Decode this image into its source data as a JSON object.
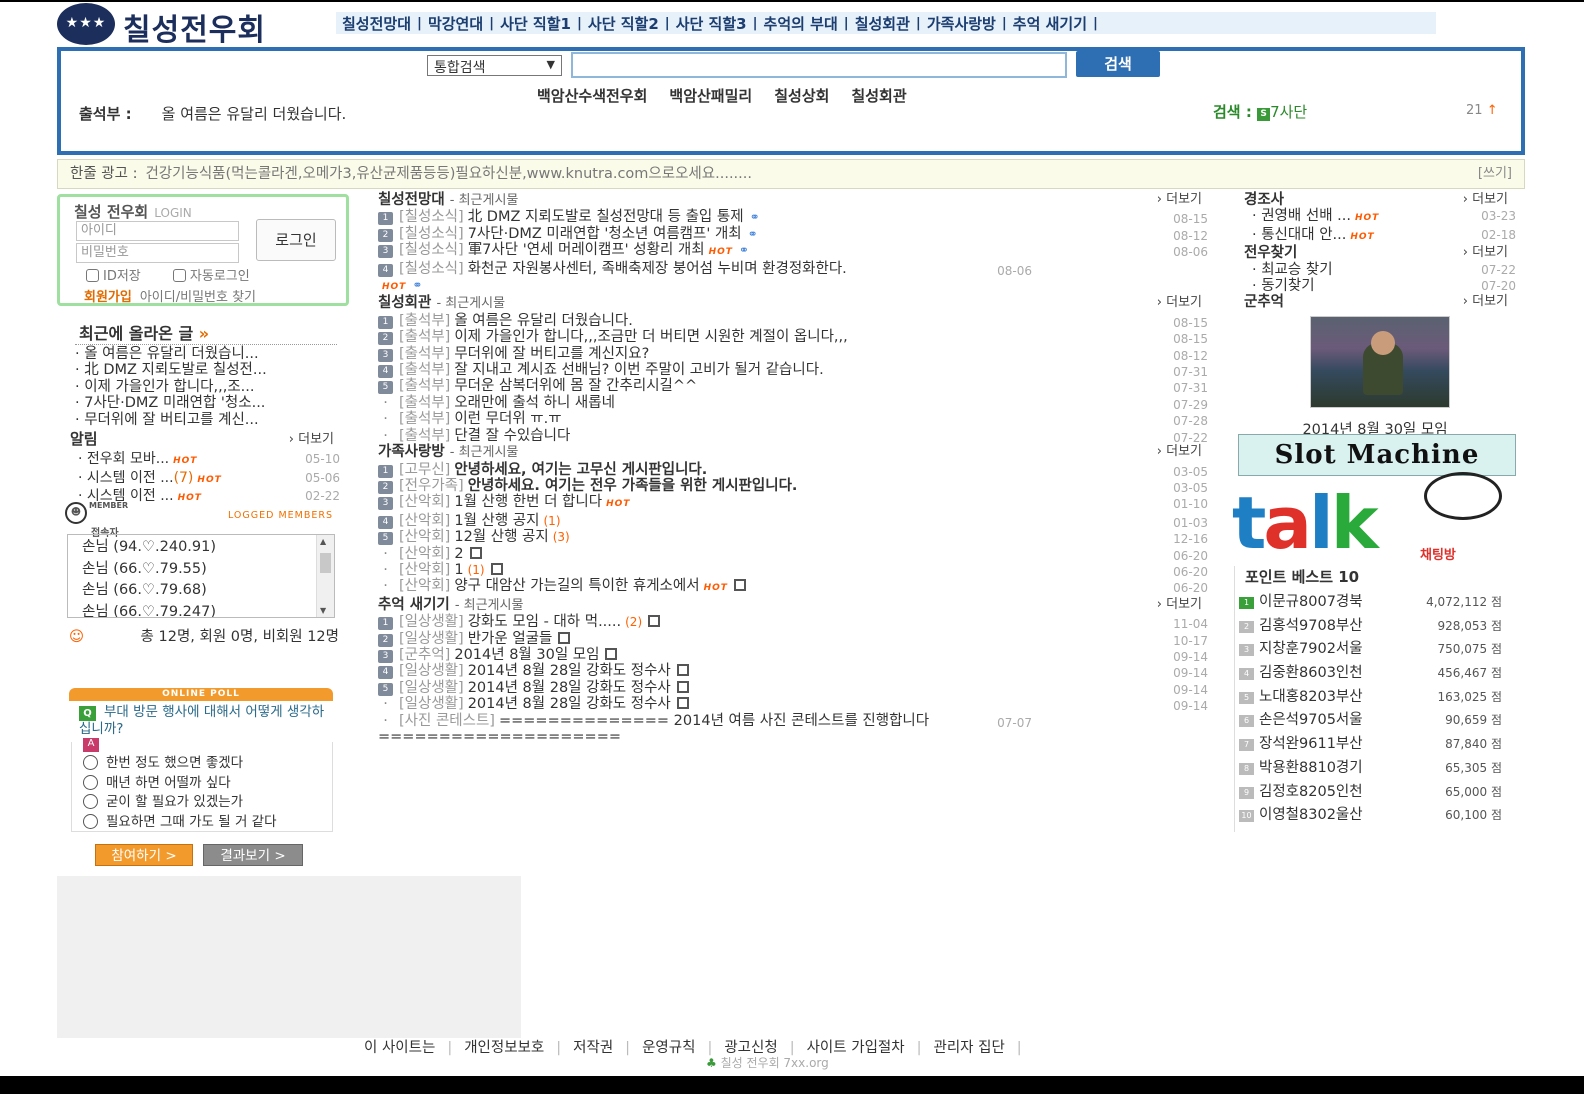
{
  "site": {
    "logo_text": "칠성전우회",
    "logo_stars": "★★★"
  },
  "topnav": [
    "칠성전망대",
    "막강연대",
    "사단 직할1",
    "사단 직할2",
    "사단 직할3",
    "추억의 부대",
    "칠성회관",
    "가족사랑방",
    "추억 새기기"
  ],
  "search": {
    "select_value": "통합검색",
    "button": "검색",
    "links": [
      "백암산수색전우회",
      "백암산패밀리",
      "칠성상회",
      "칠성회관"
    ],
    "attend_label": "출석부 :",
    "attend_text": "올 여름은 유달리 더웠습니다.",
    "find_label": "검색 :",
    "find_icon": "S",
    "find_value": "7사단",
    "count": "21",
    "count_arrow": "↑"
  },
  "ad": {
    "label": "한줄 광고 :",
    "text": "건강기능식품(먹는콜라겐,오메가3,유산균제품등등)필요하신분,www.knutra.com으로오세요........",
    "write": "[쓰기]"
  },
  "login": {
    "title": "칠성 전우회",
    "title_en": "LOGIN",
    "id_placeholder": "아이디",
    "pw_placeholder": "비밀번호",
    "button": "로그인",
    "save_id": "ID저장",
    "auto_login": "자동로그인",
    "join": "회원가입",
    "find": "아이디/비밀번호 찾기"
  },
  "recent": {
    "title": "최근에 올라온 글",
    "arrow": "»",
    "items": [
      "올 여름은 유달리 더웠습니...",
      "北 DMZ 지뢰도발로 칠성전...",
      "이제 가을인가 합니다,,,조...",
      "7사단·DMZ 미래연합 '청소...",
      "무더위에 잘 버티고를 계신..."
    ]
  },
  "notice": {
    "title": "알림",
    "more": "더보기",
    "items": [
      {
        "title": "전우회 모바...",
        "extra": "",
        "hot": "HOT",
        "date": "05-10"
      },
      {
        "title": "시스템 이전 ...",
        "extra": "(7)",
        "hot": "HOT",
        "date": "05-06"
      },
      {
        "title": "시스템 이전 ...",
        "extra": "",
        "hot": "HOT",
        "date": "02-22"
      }
    ]
  },
  "members": {
    "icon_text": "MEMBER",
    "title": "접속자",
    "logged": "LOGGED MEMBERS",
    "list": [
      "손님 (94.♡.240.91)",
      "손님 (66.♡.79.55)",
      "손님 (66.♡.79.68)",
      "손님 (66.♡.79.247)"
    ],
    "total": "총 12명, 회원 0명, 비회원 12명"
  },
  "poll": {
    "bar": "ONLINE POLL",
    "q_icon": "Q",
    "a_icon": "A",
    "question": "부대 방문 행사에 대해서 어떻게 생각하십니까?",
    "options": [
      "한번 정도 했으면 좋겠다",
      "매년 하면 어떨까 싶다",
      "굳이 할 필요가 있겠는가",
      "필요하면 그때 가도 될 거 같다"
    ],
    "vote": "참여하기 >",
    "result": "결과보기 >"
  },
  "center": {
    "more": "더보기",
    "sub": "- 최근게시물",
    "sections": [
      {
        "title": "칠성전망대",
        "rows": [
          {
            "n": "1",
            "cat": "[칠성소식]",
            "text": "北 DMZ 지뢰도발로 칠성전망대 등 출입 통제",
            "bold": false,
            "hot": "",
            "clip": "⚭",
            "cnt": "",
            "save": false,
            "date": "08-15"
          },
          {
            "n": "2",
            "cat": "[칠성소식]",
            "text": "7사단·DMZ 미래연합 '청소년 여름캠프' 개최",
            "bold": false,
            "hot": "",
            "clip": "⚭",
            "cnt": "",
            "save": false,
            "date": "08-12"
          },
          {
            "n": "3",
            "cat": "[칠성소식]",
            "text": "軍7사단 '연세 머레이캠프' 성황리 개최",
            "bold": false,
            "hot": "HOT",
            "clip": "⚭",
            "cnt": "",
            "save": false,
            "date": "08-06"
          },
          {
            "n": "4",
            "cat": "[칠성소식]",
            "text": "화천군 자원봉사센터, 족배축제장 붕어섬 누비며 환경정화한다.",
            "bold": false,
            "hot": "HOT",
            "clip": "⚭",
            "cnt": "",
            "save": false,
            "date": "08-06",
            "wrap": true
          }
        ]
      },
      {
        "title": "칠성회관",
        "rows": [
          {
            "n": "1",
            "cat": "[출석부]",
            "text": "올 여름은 유달리 더웠습니다.",
            "date": "08-15"
          },
          {
            "n": "2",
            "cat": "[출석부]",
            "text": "이제 가을인가 합니다,,,조금만 더 버티면 시원한 계절이 옵니다,,,",
            "date": "08-15"
          },
          {
            "n": "3",
            "cat": "[출석부]",
            "text": "무더위에 잘 버티고를 계신지요?",
            "date": "08-12"
          },
          {
            "n": "4",
            "cat": "[출석부]",
            "text": "잘 지내고 계시죠 선배님? 이번 주말이 고비가 될거 같습니다.",
            "date": "07-31"
          },
          {
            "n": "5",
            "cat": "[출석부]",
            "text": "무더운 삼복더위에 몸 잘 간추리시길^^",
            "date": "07-31"
          },
          {
            "n": "·",
            "cat": "[출석부]",
            "text": "오래만에 출석 하니 새롭네",
            "date": "07-29"
          },
          {
            "n": "·",
            "cat": "[출석부]",
            "text": "이런 무더위 ㅠ.ㅠ",
            "date": "07-28"
          },
          {
            "n": "·",
            "cat": "[출석부]",
            "text": "단결 잘 수있습니다",
            "date": "07-22"
          }
        ]
      },
      {
        "title": "가족사랑방",
        "rows": [
          {
            "n": "1",
            "cat": "[고무신]",
            "text": "안녕하세요, 여기는 고무신 게시판입니다.",
            "bold": true,
            "date": "03-05"
          },
          {
            "n": "2",
            "cat": "[전우가족]",
            "text": "안녕하세요. 여기는 전우 가족들을 위한 게시판입니다.",
            "bold": true,
            "date": "03-05"
          },
          {
            "n": "3",
            "cat": "[산악회]",
            "text": "1월 산행 한번 더 합니다",
            "hot": "HOT",
            "date": "01-10"
          },
          {
            "n": "4",
            "cat": "[산악회]",
            "text": "1월 산행 공지",
            "cnt": "(1)",
            "date": "01-03"
          },
          {
            "n": "5",
            "cat": "[산악회]",
            "text": "12월 산행 공지",
            "cnt": "(3)",
            "date": "12-16"
          },
          {
            "n": "·",
            "cat": "[산악회]",
            "text": "2",
            "save": true,
            "date": "06-20"
          },
          {
            "n": "·",
            "cat": "[산악회]",
            "text": "1",
            "cnt": "(1)",
            "save": true,
            "date": "06-20"
          },
          {
            "n": "·",
            "cat": "[산악회]",
            "text": "양구 대암산 가는길의 특이한 휴게소에서",
            "hot": "HOT",
            "save": true,
            "date": "06-20"
          }
        ]
      },
      {
        "title": "추억 새기기",
        "rows": [
          {
            "n": "1",
            "cat": "[일상생활]",
            "text": "강화도 모임 - 대하 먹.....",
            "cnt": "(2)",
            "save": true,
            "date": "11-04"
          },
          {
            "n": "2",
            "cat": "[일상생활]",
            "text": "반가운 얼굴들",
            "save": true,
            "date": "10-17"
          },
          {
            "n": "3",
            "cat": "[군추억]",
            "text": "2014년 8월 30일 모임",
            "save": true,
            "date": "09-14"
          },
          {
            "n": "4",
            "cat": "[일상생활]",
            "text": "2014년 8월 28일 강화도 정수사",
            "save": true,
            "date": "09-14"
          },
          {
            "n": "5",
            "cat": "[일상생활]",
            "text": "2014년 8월 28일 강화도 정수사",
            "save": true,
            "date": "09-14"
          },
          {
            "n": "·",
            "cat": "[일상생활]",
            "text": "2014년 8월 28일 강화도 정수사",
            "save": true,
            "date": "09-14"
          },
          {
            "n": "·",
            "cat": "[사진 콘테스트]",
            "text": "============== 2014년 여름 사진 콘테스트를 진행합니다 ====================",
            "date": "07-07",
            "wrap": true
          }
        ]
      }
    ]
  },
  "right": {
    "more": "더보기",
    "gyeongjosa": {
      "title": "경조사",
      "items": [
        {
          "t": "권영배 선배 ...",
          "hot": "HOT",
          "d": "03-23"
        },
        {
          "t": "통신대대 안...",
          "hot": "HOT",
          "d": "02-18"
        }
      ]
    },
    "find": {
      "title": "전우찾기",
      "items": [
        {
          "t": "최교승 찾기",
          "hot": "",
          "d": "07-22"
        },
        {
          "t": "동기찾기",
          "hot": "",
          "d": "07-20"
        }
      ]
    },
    "album": {
      "title": "군추억",
      "caption": "2014년 8월 30일 모임"
    },
    "slot": "Slot Machine",
    "talk": {
      "word": "talk",
      "label": "채팅방"
    },
    "points": {
      "title": "포인트 베스트 10",
      "items": [
        {
          "n": "1",
          "name": "이문규8007경북",
          "v": "4,072,112 점"
        },
        {
          "n": "2",
          "name": "김홍석9708부산",
          "v": "928,053 점"
        },
        {
          "n": "3",
          "name": "지창훈7902서울",
          "v": "750,075 점"
        },
        {
          "n": "4",
          "name": "김중환8603인천",
          "v": "456,467 점"
        },
        {
          "n": "5",
          "name": "노대홍8203부산",
          "v": "163,025 점"
        },
        {
          "n": "6",
          "name": "손은석9705서울",
          "v": "90,659 점"
        },
        {
          "n": "7",
          "name": "장석완9611부산",
          "v": "87,840 점"
        },
        {
          "n": "8",
          "name": "박용환8810경기",
          "v": "65,305 점"
        },
        {
          "n": "9",
          "name": "김정호8205인천",
          "v": "65,000 점"
        },
        {
          "n": "10",
          "name": "이영철8302울산",
          "v": "60,100 점"
        }
      ]
    }
  },
  "footer": {
    "links": [
      "이 사이트는",
      "개인정보보호",
      "저작권",
      "운영규칙",
      "광고신청",
      "사이트 가입절차",
      "관리자 집단"
    ],
    "copy": "칠성 전우회 7xx.org",
    "copy_icon": "♣"
  },
  "colors": {
    "brand": "#1b2e5c",
    "accent": "#2e6fb3",
    "hot": "#ff5a00",
    "green": "#3aa03a",
    "orange": "#f39a2c"
  }
}
